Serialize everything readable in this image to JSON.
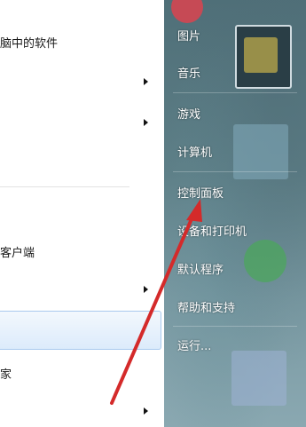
{
  "left_menu": {
    "items": [
      {
        "label": "脑中的软件"
      },
      {
        "label": "客户端"
      },
      {
        "label": "家"
      }
    ]
  },
  "right_menu": {
    "items": [
      {
        "label": "图片"
      },
      {
        "label": "音乐"
      },
      {
        "label": "游戏"
      },
      {
        "label": "计算机"
      },
      {
        "label": "控制面板"
      },
      {
        "label": "设备和打印机"
      },
      {
        "label": "默认程序"
      },
      {
        "label": "帮助和支持"
      },
      {
        "label": "运行..."
      }
    ]
  },
  "colors": {
    "arrow": "#d42a2a",
    "highlight": "#dcebfb",
    "right_pane": "#5d7e86"
  },
  "icons": [
    "chevron-right-icon",
    "red-arrow-annotation"
  ]
}
